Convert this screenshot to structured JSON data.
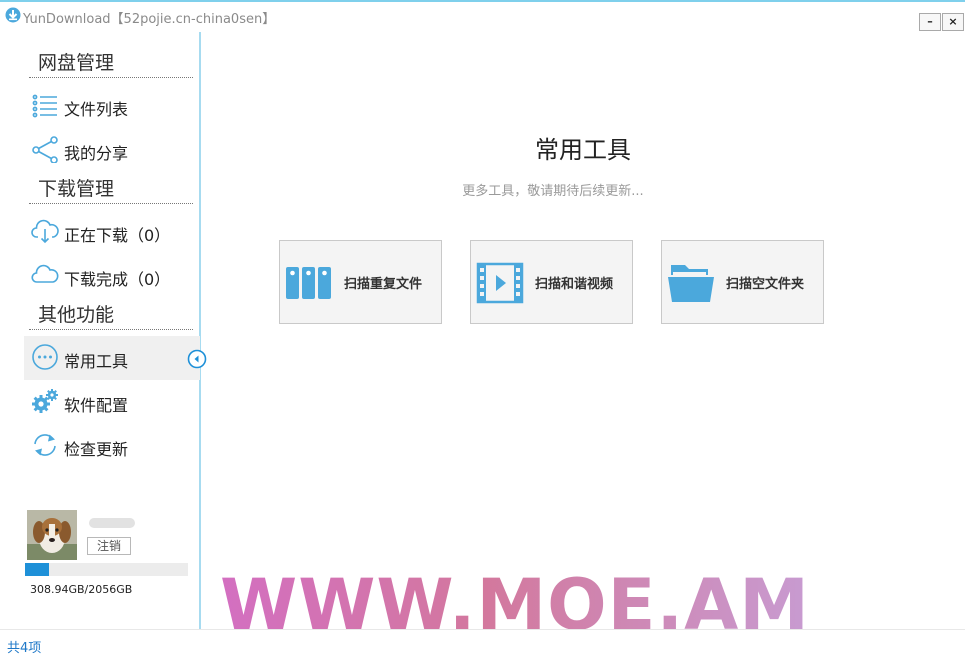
{
  "window": {
    "title": "YunDownload【52pojie.cn-china0sen】",
    "minimize_label": "–",
    "close_label": "×"
  },
  "sidebar": {
    "sections": [
      {
        "title": "网盘管理"
      },
      {
        "title": "下载管理"
      },
      {
        "title": "其他功能"
      }
    ],
    "items": [
      {
        "label": "文件列表",
        "icon": "list-icon"
      },
      {
        "label": "我的分享",
        "icon": "share-icon"
      },
      {
        "label": "正在下载（0）",
        "icon": "cloud-download-icon"
      },
      {
        "label": "下载完成（0）",
        "icon": "cloud-icon"
      },
      {
        "label": "常用工具",
        "icon": "more-icon",
        "active": true
      },
      {
        "label": "软件配置",
        "icon": "gears-icon"
      },
      {
        "label": "检查更新",
        "icon": "refresh-icon"
      }
    ]
  },
  "user": {
    "logout_label": "注销",
    "storage_text": "308.94GB/2056GB",
    "storage_used_fraction": 0.15
  },
  "main": {
    "title": "常用工具",
    "subtitle": "更多工具，敬请期待后续更新...",
    "tools": [
      {
        "label": "扫描重复文件",
        "icon": "duplicate-files-icon"
      },
      {
        "label": "扫描和谐视频",
        "icon": "video-icon"
      },
      {
        "label": "扫描空文件夹",
        "icon": "folder-icon"
      }
    ]
  },
  "watermark": {
    "text": "WWW.MOE.AM"
  },
  "status": {
    "text": "共4项"
  },
  "colors": {
    "accent": "#1e90d8",
    "icon_blue": "#4ba8dc",
    "sidebar_border": "#a7dbf0"
  }
}
